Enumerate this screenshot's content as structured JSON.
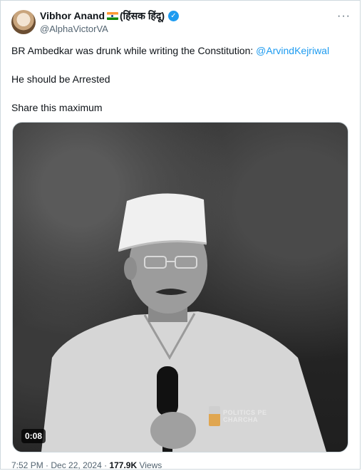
{
  "tweet": {
    "author_name": "Vibhor Anand",
    "author_suffix": "(हिंसक हिंदू)",
    "handle": "@AlphaVictorVA",
    "text_line1": "BR Ambedkar was drunk while writing the Constitution: ",
    "mention": "@ArvindKejriwal",
    "text_line2": "He should be Arrested",
    "text_line3": "Share this maximum",
    "more_icon": "···",
    "verified_icon": "✓"
  },
  "media": {
    "duration": "0:08",
    "watermark_line1": "POLITICS PE",
    "watermark_line2": "CHARCHA"
  },
  "meta": {
    "time": "7:52 PM",
    "separator1": " · ",
    "date": "Dec 22, 2024",
    "separator2": " · ",
    "views_count": "177.9K",
    "views_label": " Views"
  }
}
